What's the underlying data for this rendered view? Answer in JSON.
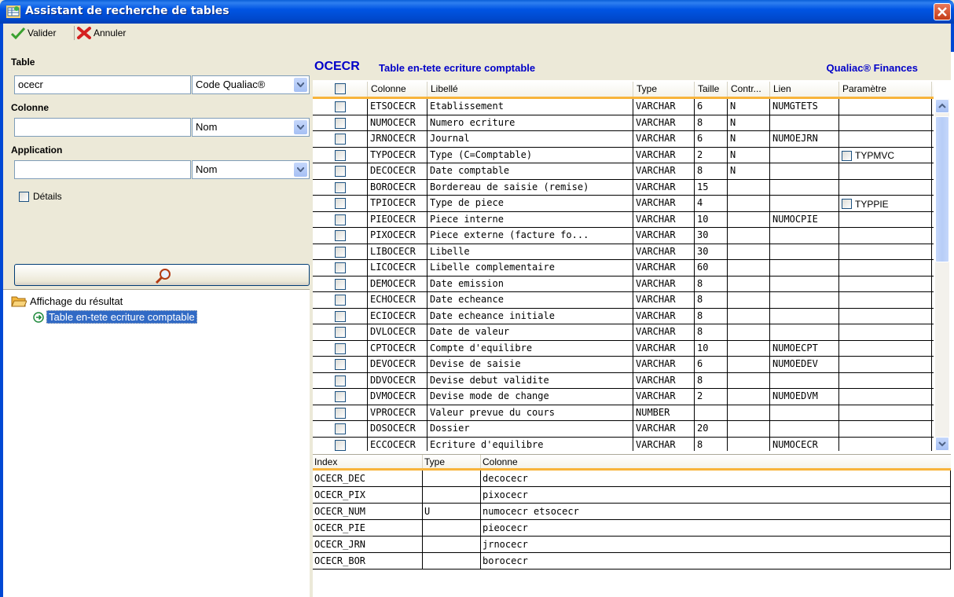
{
  "window": {
    "title": "Assistant de recherche de tables",
    "icons": {
      "app": "table-wizard-icon",
      "close": "close-icon"
    }
  },
  "toolbar": {
    "valider_label": "Valider",
    "annuler_label": "Annuler",
    "icons": {
      "valider": "checkmark-icon",
      "annuler": "red-x-icon"
    }
  },
  "search": {
    "table_label": "Table",
    "table_value": "ocecr",
    "table_mode": "Code Qualiac®",
    "colonne_label": "Colonne",
    "colonne_value": "",
    "colonne_mode": "Nom",
    "application_label": "Application",
    "application_value": "",
    "application_mode": "Nom",
    "details_label": "Détails",
    "details_checked": false,
    "search_icon": "magnifier-icon"
  },
  "tree": {
    "root_label": "Affichage du résultat",
    "child_label": "Table en-tete ecriture comptable",
    "root_icon": "folder-open-icon",
    "child_icon": "arrow-circle-icon"
  },
  "detail": {
    "table_code": "OCECR",
    "table_desc": "Table en-tete ecriture comptable",
    "brand": "Qualiac® Finances",
    "header_color": "#0000c8"
  },
  "columns_grid": {
    "headers": [
      "",
      "Colonne",
      "Libellé",
      "Type",
      "Taille",
      "Contr...",
      "Lien",
      "Paramètre"
    ],
    "rows": [
      {
        "col": "ETSOCECR",
        "lib": "Etablissement",
        "type": "VARCHAR",
        "taille": "6",
        "contr": "N",
        "lien": "NUMGTETS",
        "param": ""
      },
      {
        "col": "NUMOCECR",
        "lib": "Numero ecriture",
        "type": "VARCHAR",
        "taille": "8",
        "contr": "N",
        "lien": "",
        "param": ""
      },
      {
        "col": "JRNOCECR",
        "lib": "Journal",
        "type": "VARCHAR",
        "taille": "6",
        "contr": "N",
        "lien": "NUMOEJRN",
        "param": ""
      },
      {
        "col": "TYPOCECR",
        "lib": "Type (C=Comptable)",
        "type": "VARCHAR",
        "taille": "2",
        "contr": "N",
        "lien": "",
        "param": "TYPMVC"
      },
      {
        "col": "DECOCECR",
        "lib": "Date comptable",
        "type": "VARCHAR",
        "taille": "8",
        "contr": "N",
        "lien": "",
        "param": ""
      },
      {
        "col": "BOROCECR",
        "lib": "Bordereau de saisie (remise)",
        "type": "VARCHAR",
        "taille": "15",
        "contr": "",
        "lien": "",
        "param": ""
      },
      {
        "col": "TPIOCECR",
        "lib": "Type de piece",
        "type": "VARCHAR",
        "taille": "4",
        "contr": "",
        "lien": "",
        "param": "TYPPIE"
      },
      {
        "col": "PIEOCECR",
        "lib": "Piece interne",
        "type": "VARCHAR",
        "taille": "10",
        "contr": "",
        "lien": "NUMOCPIE",
        "param": ""
      },
      {
        "col": "PIXOCECR",
        "lib": "Piece externe (facture fo...",
        "type": "VARCHAR",
        "taille": "30",
        "contr": "",
        "lien": "",
        "param": ""
      },
      {
        "col": "LIBOCECR",
        "lib": "Libelle",
        "type": "VARCHAR",
        "taille": "30",
        "contr": "",
        "lien": "",
        "param": ""
      },
      {
        "col": "LICOCECR",
        "lib": "Libelle complementaire",
        "type": "VARCHAR",
        "taille": "60",
        "contr": "",
        "lien": "",
        "param": ""
      },
      {
        "col": "DEMOCECR",
        "lib": "Date emission",
        "type": "VARCHAR",
        "taille": "8",
        "contr": "",
        "lien": "",
        "param": ""
      },
      {
        "col": "ECHOCECR",
        "lib": "Date echeance",
        "type": "VARCHAR",
        "taille": "8",
        "contr": "",
        "lien": "",
        "param": ""
      },
      {
        "col": "ECIOCECR",
        "lib": "Date echeance initiale",
        "type": "VARCHAR",
        "taille": "8",
        "contr": "",
        "lien": "",
        "param": ""
      },
      {
        "col": "DVLOCECR",
        "lib": "Date de valeur",
        "type": "VARCHAR",
        "taille": "8",
        "contr": "",
        "lien": "",
        "param": ""
      },
      {
        "col": "CPTOCECR",
        "lib": "Compte d'equilibre",
        "type": "VARCHAR",
        "taille": "10",
        "contr": "",
        "lien": "NUMOECPT",
        "param": ""
      },
      {
        "col": "DEVOCECR",
        "lib": "Devise de saisie",
        "type": "VARCHAR",
        "taille": "6",
        "contr": "",
        "lien": "NUMOEDEV",
        "param": ""
      },
      {
        "col": "DDVOCECR",
        "lib": "Devise debut validite",
        "type": "VARCHAR",
        "taille": "8",
        "contr": "",
        "lien": "",
        "param": ""
      },
      {
        "col": "DVMOCECR",
        "lib": "Devise mode de change",
        "type": "VARCHAR",
        "taille": "2",
        "contr": "",
        "lien": "NUMOEDVM",
        "param": ""
      },
      {
        "col": "VPROCECR",
        "lib": "Valeur prevue du cours",
        "type": "NUMBER",
        "taille": "",
        "contr": "",
        "lien": "",
        "param": ""
      },
      {
        "col": "DOSOCECR",
        "lib": "Dossier",
        "type": "VARCHAR",
        "taille": "20",
        "contr": "",
        "lien": "",
        "param": ""
      },
      {
        "col": "ECCOCECR",
        "lib": "Ecriture d'equilibre",
        "type": "VARCHAR",
        "taille": "8",
        "contr": "",
        "lien": "NUMOCECR",
        "param": ""
      }
    ]
  },
  "index_grid": {
    "headers": [
      "Index",
      "Type",
      "Colonne"
    ],
    "rows": [
      {
        "index": "OCECR_DEC",
        "type": "",
        "colonne": "decocecr"
      },
      {
        "index": "OCECR_PIX",
        "type": "",
        "colonne": "pixocecr"
      },
      {
        "index": "OCECR_NUM",
        "type": "U",
        "colonne": "numocecr etsocecr"
      },
      {
        "index": "OCECR_PIE",
        "type": "",
        "colonne": "pieocecr"
      },
      {
        "index": "OCECR_JRN",
        "type": "",
        "colonne": "jrnocecr"
      },
      {
        "index": "OCECR_BOR",
        "type": "",
        "colonne": "borocecr"
      }
    ]
  }
}
